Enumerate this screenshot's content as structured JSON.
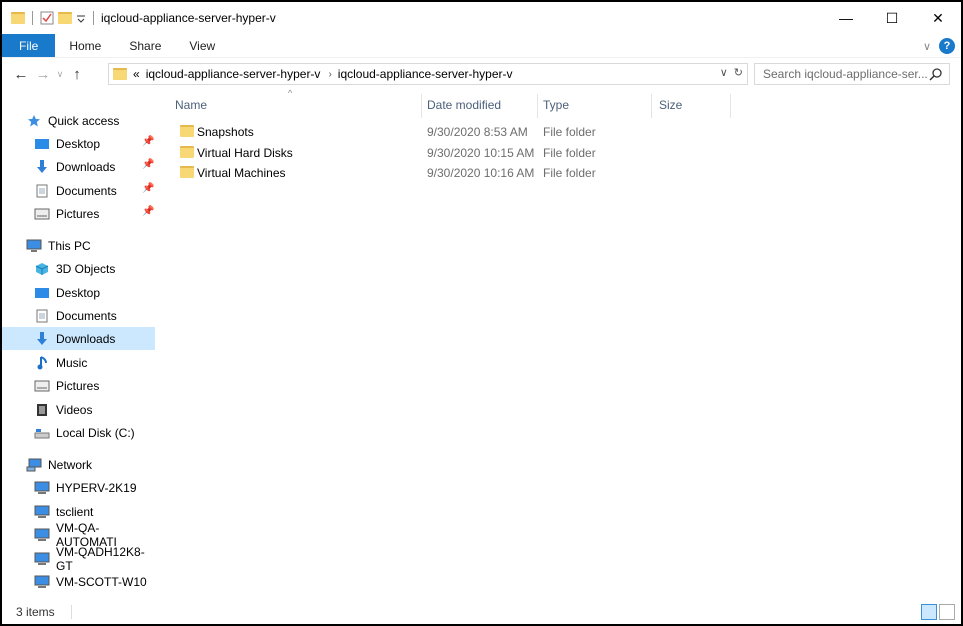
{
  "window": {
    "title": "iqcloud-appliance-server-hyper-v",
    "controls": {
      "minimize": "—",
      "maximize": "☐",
      "close": "✕"
    }
  },
  "ribbon": {
    "tabs": [
      "File",
      "Home",
      "Share",
      "View"
    ],
    "help": "?"
  },
  "address": {
    "overflow": "«",
    "crumbs": [
      "iqcloud-appliance-server-hyper-v",
      "iqcloud-appliance-server-hyper-v"
    ],
    "search_placeholder": "Search iqcloud-appliance-ser..."
  },
  "nav": {
    "quick_access": "Quick access",
    "quick_items": [
      {
        "label": "Desktop",
        "icon": "desktop-icon"
      },
      {
        "label": "Downloads",
        "icon": "download-icon"
      },
      {
        "label": "Documents",
        "icon": "documents-icon"
      },
      {
        "label": "Pictures",
        "icon": "pictures-icon"
      }
    ],
    "this_pc": "This PC",
    "pc_items": [
      {
        "label": "3D Objects",
        "icon": "3d-objects-icon"
      },
      {
        "label": "Desktop",
        "icon": "desktop-icon"
      },
      {
        "label": "Documents",
        "icon": "documents-icon"
      },
      {
        "label": "Downloads",
        "icon": "download-icon",
        "selected": true
      },
      {
        "label": "Music",
        "icon": "music-icon"
      },
      {
        "label": "Pictures",
        "icon": "pictures-icon"
      },
      {
        "label": "Videos",
        "icon": "videos-icon"
      },
      {
        "label": "Local Disk (C:)",
        "icon": "drive-icon"
      }
    ],
    "network": "Network",
    "net_items": [
      {
        "label": "HYPERV-2K19"
      },
      {
        "label": "tsclient"
      },
      {
        "label": "VM-QA-AUTOMATI"
      },
      {
        "label": "VM-QADH12K8-GT"
      },
      {
        "label": "VM-SCOTT-W10"
      }
    ]
  },
  "columns": {
    "name": "Name",
    "date": "Date modified",
    "type": "Type",
    "size": "Size"
  },
  "files": [
    {
      "name": "Snapshots",
      "date": "9/30/2020 8:53 AM",
      "type": "File folder",
      "size": ""
    },
    {
      "name": "Virtual Hard Disks",
      "date": "9/30/2020 10:15 AM",
      "type": "File folder",
      "size": ""
    },
    {
      "name": "Virtual Machines",
      "date": "9/30/2020 10:16 AM",
      "type": "File folder",
      "size": ""
    }
  ],
  "status": {
    "count": "3 items"
  },
  "colors": {
    "accent": "#1979ca",
    "selection": "#cce8ff",
    "folder": "#f8d775"
  }
}
